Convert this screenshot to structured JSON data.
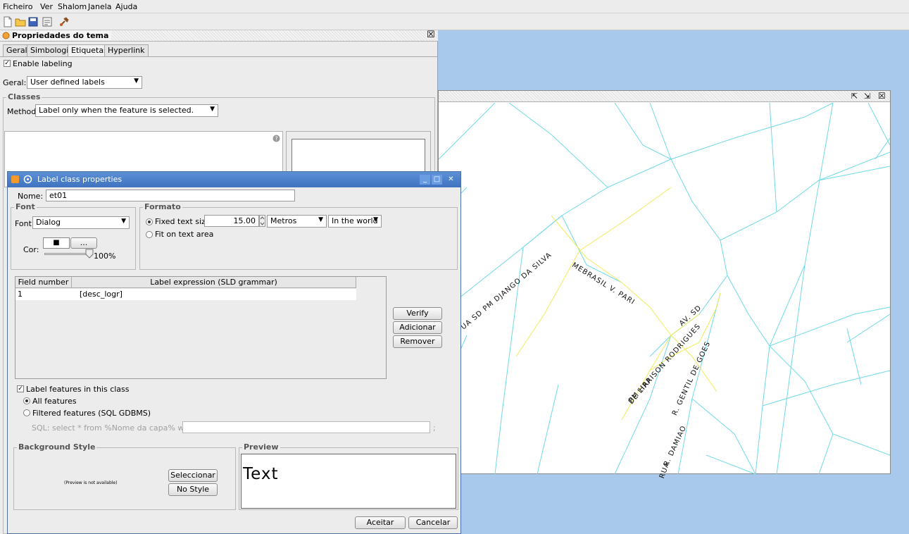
{
  "menu": [
    "Ficheiro",
    "Ver",
    "Shalom",
    "Janela",
    "Ajuda"
  ],
  "properties_panel": {
    "title": "Propriedades do tema",
    "close_glyph": "☒",
    "tabs": [
      "Geral",
      "Simbologia",
      "Etiquetas",
      "Hyperlink"
    ],
    "active_tab": "Etiquetas",
    "enable_labeling": "Enable labeling",
    "geral_label": "Geral:",
    "geral_value": "User defined labels",
    "classes_label": "Classes",
    "method_label": "Method:",
    "method_value": "Label only when the feature is selected."
  },
  "map_window": {
    "icons": [
      "restore-icon",
      "maximize-icon",
      "close-icon"
    ],
    "close_glyph": "☒",
    "restore_glyph": "⇱",
    "maximize_glyph": "⇲",
    "street_labels": [
      "UA SD PM DJANGO DA SILVA",
      "MEBRASIL V. PARI",
      "AV. SD",
      "PM HARISON RODRIGUES",
      "DE LIRA",
      "R. GENTIL DE GOES",
      "R. DAMIAO",
      "RUA"
    ]
  },
  "dialog": {
    "title": "Label class properties",
    "minimize_glyph": "_",
    "maximize_glyph": "□",
    "close_glyph": "✕",
    "name_label": "Nome:",
    "name_value": "et01",
    "font_group": "Font",
    "font_label": "Font",
    "font_value": "Dialog",
    "color_label": "Cor:",
    "color_button": "...",
    "color_swatch": "■",
    "opacity": "100%",
    "formato_group": "Formato",
    "fixed_text_size": "Fixed text size",
    "size_value": "15.00",
    "units_value": "Metros",
    "world_value": "In the world",
    "fit_on_text_area": "Fit on text area",
    "table_headers": [
      "Field number",
      "Label expression (SLD grammar)"
    ],
    "table_rows": [
      {
        "field": "1",
        "expression": "[desc_logr]"
      }
    ],
    "verify": "Verify",
    "add": "Adicionar",
    "remove": "Remover",
    "label_features": "Label features in this class",
    "all_features": "All features",
    "filtered_features": "Filtered features (SQL GDBMS)",
    "sql_label": "SQL: select * from  %Nome da capa%  where",
    "sql_tail": ";",
    "background_group": "Background Style",
    "preview_na": "(Preview is not available)",
    "select_btn": "Seleccionar",
    "no_style_btn": "No Style",
    "preview_group": "Preview",
    "preview_text": "Text",
    "accept": "Aceitar",
    "cancel": "Cancelar"
  },
  "colors": {
    "map_background": "#a8c8ec",
    "road_cyan": "#6fd9e8",
    "road_yellow": "#f2ea5a",
    "title_blue": "#4a7fcb"
  }
}
